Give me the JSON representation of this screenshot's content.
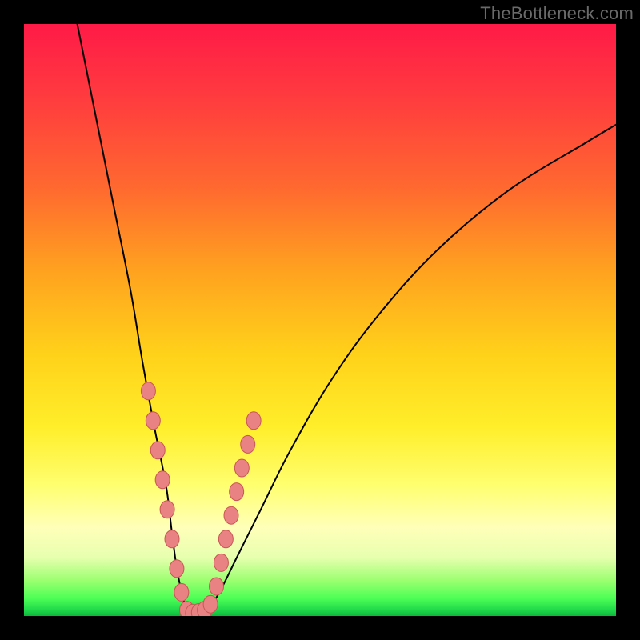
{
  "watermark": "TheBottleneck.com",
  "colors": {
    "bg": "#000000",
    "gradient_top": "#ff1a47",
    "gradient_mid1": "#ffa31f",
    "gradient_mid2": "#ffee2a",
    "gradient_bottom": "#0eb83a",
    "curve": "#000000",
    "marker_fill": "#e98383",
    "marker_stroke": "#c95555"
  },
  "chart_data": {
    "type": "line",
    "title": "",
    "xlabel": "",
    "ylabel": "",
    "xlim": [
      0,
      100
    ],
    "ylim": [
      0,
      100
    ],
    "note": "Axes are unlabeled; x roughly = component scale, y roughly = bottleneck %. Values are estimated from pixel positions.",
    "series": [
      {
        "name": "bottleneck-curve",
        "x": [
          9,
          12,
          15,
          18,
          20,
          22,
          24,
          25,
          26,
          27.5,
          29,
          31,
          33,
          36,
          40,
          45,
          52,
          60,
          70,
          82,
          95,
          100
        ],
        "y": [
          100,
          85,
          70,
          55,
          43,
          32,
          22,
          14,
          7,
          1,
          0.5,
          1,
          4,
          10,
          18,
          28,
          40,
          51,
          62,
          72,
          80,
          83
        ]
      }
    ],
    "markers": {
      "name": "highlighted-points",
      "note": "Pink bead markers clustered near the valley on both branches.",
      "points": [
        {
          "x": 21.0,
          "y": 38
        },
        {
          "x": 21.8,
          "y": 33
        },
        {
          "x": 22.6,
          "y": 28
        },
        {
          "x": 23.4,
          "y": 23
        },
        {
          "x": 24.2,
          "y": 18
        },
        {
          "x": 25.0,
          "y": 13
        },
        {
          "x": 25.8,
          "y": 8
        },
        {
          "x": 26.6,
          "y": 4
        },
        {
          "x": 27.5,
          "y": 1
        },
        {
          "x": 28.5,
          "y": 0.5
        },
        {
          "x": 29.5,
          "y": 0.6
        },
        {
          "x": 30.5,
          "y": 1.0
        },
        {
          "x": 31.5,
          "y": 2
        },
        {
          "x": 32.5,
          "y": 5
        },
        {
          "x": 33.3,
          "y": 9
        },
        {
          "x": 34.1,
          "y": 13
        },
        {
          "x": 35.0,
          "y": 17
        },
        {
          "x": 35.9,
          "y": 21
        },
        {
          "x": 36.8,
          "y": 25
        },
        {
          "x": 37.8,
          "y": 29
        },
        {
          "x": 38.8,
          "y": 33
        }
      ]
    }
  }
}
